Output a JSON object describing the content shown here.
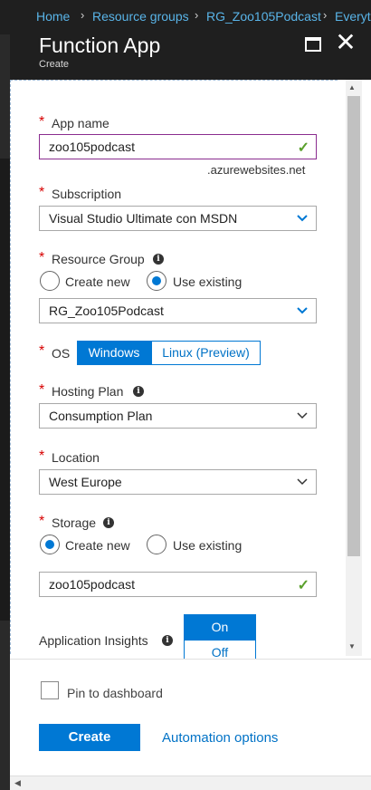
{
  "breadcrumb": {
    "items": [
      "Home",
      "Resource groups",
      "RG_Zoo105Podcast",
      "Everyth"
    ]
  },
  "header": {
    "title": "Function App",
    "subtitle": "Create"
  },
  "form": {
    "app_name": {
      "label": "App name",
      "value": "zoo105podcast",
      "suffix": ".azurewebsites.net"
    },
    "subscription": {
      "label": "Subscription",
      "value": "Visual Studio Ultimate con MSDN"
    },
    "resource_group": {
      "label": "Resource Group",
      "option_new": "Create new",
      "option_existing": "Use existing",
      "selected": "Use existing",
      "value": "RG_Zoo105Podcast"
    },
    "os": {
      "label": "OS",
      "options": [
        "Windows",
        "Linux (Preview)"
      ],
      "selected": "Windows"
    },
    "hosting_plan": {
      "label": "Hosting Plan",
      "value": "Consumption Plan"
    },
    "location": {
      "label": "Location",
      "value": "West Europe"
    },
    "storage": {
      "label": "Storage",
      "option_new": "Create new",
      "option_existing": "Use existing",
      "selected": "Create new",
      "value": "zoo105podcast"
    },
    "app_insights": {
      "label": "Application Insights",
      "options": [
        "On",
        "Off"
      ],
      "selected": "On"
    }
  },
  "footer": {
    "pin_label": "Pin to dashboard",
    "create_label": "Create",
    "automation_label": "Automation options"
  },
  "colors": {
    "accent": "#0078d4",
    "link": "#0072c6",
    "required": "#d70000",
    "valid": "#5aa02c",
    "focus_border": "#8a2c8f"
  }
}
